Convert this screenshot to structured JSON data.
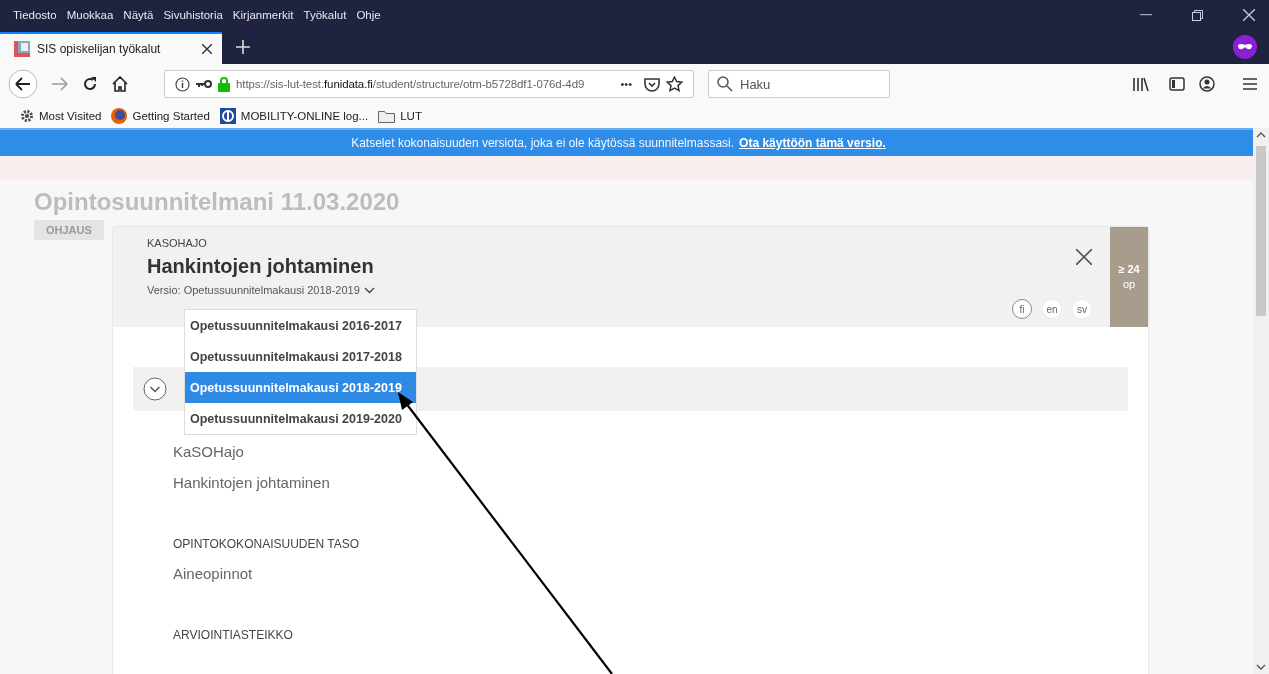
{
  "menu_bar": [
    "Tiedosto",
    "Muokkaa",
    "Näytä",
    "Sivuhistoria",
    "Kirjanmerkit",
    "Työkalut",
    "Ohje"
  ],
  "tabs": [
    {
      "title": "SIS opiskelijan työkalut",
      "selected": true
    }
  ],
  "address_bar": {
    "url": "https://sis-lut-test.**funidata.fi**/student/structure/otm-b5728df1-076d-4d9",
    "more": "•••"
  },
  "search": {
    "placeholder": "Haku"
  },
  "bookmarks": [
    {
      "label": "Most Visited",
      "kind": "gear"
    },
    {
      "label": "Getting Started",
      "kind": "globe"
    },
    {
      "label": "MOBILITY-ONLINE log...",
      "kind": "site"
    },
    {
      "label": "LUT",
      "kind": "folder"
    }
  ],
  "banner": {
    "message": "Katselet kokonaisuuden versiota, joka ei ole käytössä suunnitelmassasi.",
    "link": "Ota käyttöön tämä versio."
  },
  "background": {
    "plan_title": "Opintosuunnitelmani 11.03.2020",
    "guidance_button": "OHJAUS"
  },
  "modal": {
    "code": "KASOHAJO",
    "title": "Hankintojen johtaminen",
    "version_label": "Versio: Opetussuunnitelmakausi 2018-2019",
    "credits": "≥ 24",
    "credits_unit": "op",
    "languages": [
      {
        "code": "fi",
        "selected": true
      },
      {
        "code": "en",
        "selected": false
      },
      {
        "code": "sv",
        "selected": false
      }
    ],
    "version_options": [
      {
        "label": "Opetussuunnitelmakausi 2016-2017",
        "selected": false
      },
      {
        "label": "Opetussuunnitelmakausi 2017-2018",
        "selected": false
      },
      {
        "label": "Opetussuunnitelmakausi 2018-2019",
        "selected": true
      },
      {
        "label": "Opetussuunnitelmakausi 2019-2020",
        "selected": false
      }
    ],
    "names": [
      "KaSOHajo",
      "Hankintojen johtaminen"
    ],
    "sections": [
      {
        "heading": "OPINTOKOKONAISUUDEN TASO",
        "value": "Aineopinnot"
      },
      {
        "heading": "ARVIOINTIASTEIKKO"
      }
    ]
  }
}
